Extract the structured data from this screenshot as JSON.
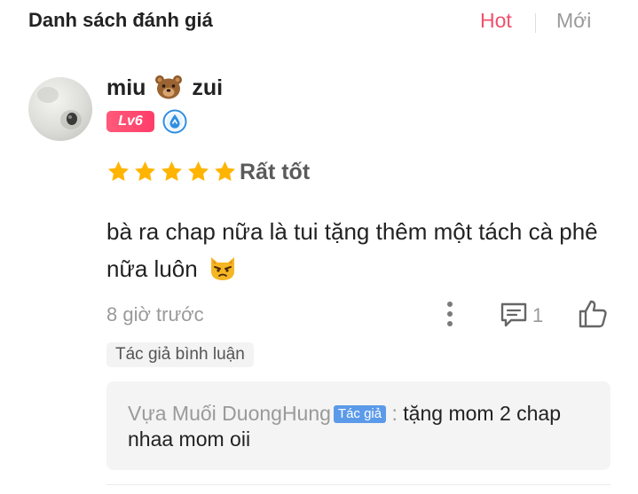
{
  "header": {
    "title": "Danh sách đánh giá",
    "sort_hot": "Hot",
    "sort_new": "Mới"
  },
  "review": {
    "username_left": "miu",
    "username_emoji": "bear-face-icon",
    "username_right": "zui",
    "level": "Lv6",
    "verified_icon": "water-drop-badge-icon",
    "rating_stars": 5,
    "rating_max": 5,
    "rating_label": "Rất tốt",
    "comment": "bà ra chap nữa là tui tặng thêm một tách cà phê nữa luôn",
    "comment_emoji": "pouting-cat-icon",
    "timestamp": "8 giờ trước",
    "reply_count": "1",
    "author_tag": "Tác giả bình luận"
  },
  "reply": {
    "author": "Vựa Muối DuongHung",
    "author_badge": "Tác giả",
    "separator": ":",
    "text": "tặng mom 2 chap nhaa mom oii"
  },
  "colors": {
    "accent": "#f0506e",
    "star": "#ffb400",
    "muted": "#9a9a9a",
    "author_badge": "#5b9ae9"
  }
}
